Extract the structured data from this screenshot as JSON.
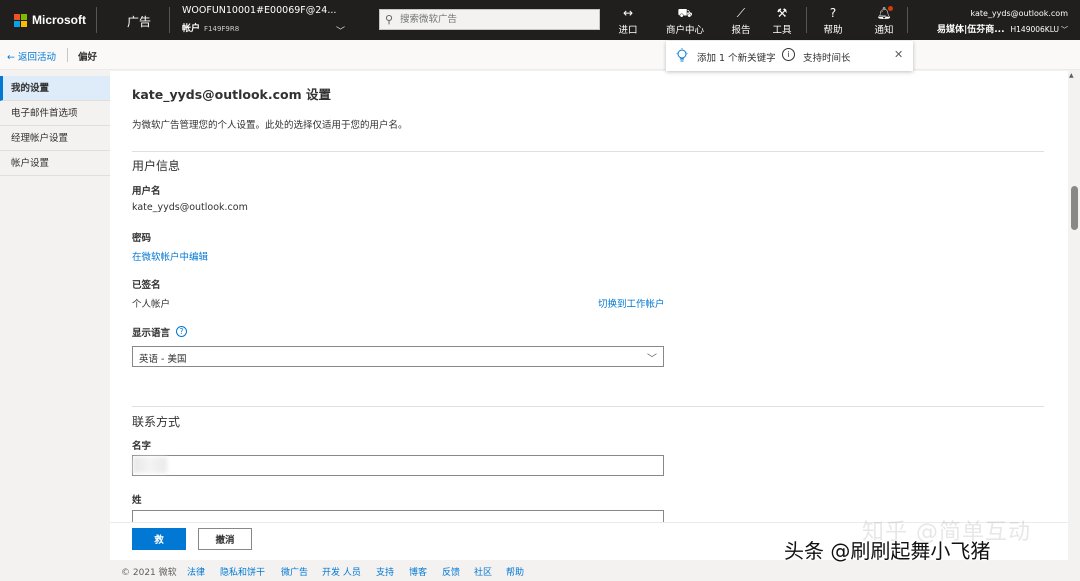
{
  "topbar": {
    "brand": "Microsoft",
    "product": "广告",
    "account": {
      "line1": "WOOFUN10001#E00069F@24...",
      "label": "帐户",
      "id": "F149F9R8"
    },
    "search": {
      "placeholder": "搜索微软广告"
    },
    "items": [
      {
        "icon": "import-icon",
        "label": "进口"
      },
      {
        "icon": "cart-icon",
        "label": "商户中心"
      },
      {
        "icon": "chart-icon",
        "label": "报告"
      },
      {
        "icon": "wrench-icon",
        "label": "工具"
      },
      {
        "icon": "help-icon",
        "label": "帮助"
      },
      {
        "icon": "bell-icon",
        "label": "通知"
      }
    ],
    "user": {
      "email": "kate_yyds@outlook.com",
      "org": "易媒体|伍芬商...",
      "id": "H149006KLU"
    }
  },
  "breadcrumb": {
    "back": "返回活动",
    "current": "偏好"
  },
  "notification": {
    "text1": "添加 1 个新关键字",
    "text2": "支持时间长"
  },
  "leftnav": {
    "items": [
      "我的设置",
      "电子邮件首选项",
      "经理帐户设置",
      "帐户设置"
    ]
  },
  "main": {
    "title": "kate_yyds@outlook.com 设置",
    "description": "为微软广告管理您的个人设置。此处的选择仅适用于您的用户名。",
    "user_info": {
      "section_title": "用户信息",
      "username_label": "用户名",
      "username_value": "kate_yyds@outlook.com",
      "password_label": "密码",
      "password_link": "在微软帐户中编辑",
      "signed_label": "已签名",
      "signed_value": "个人帐户",
      "switch_link": "切换到工作帐户",
      "language_label": "显示语言",
      "language_value": "英语 - 美国"
    },
    "contact": {
      "section_title": "联系方式",
      "first_name_label": "名字",
      "last_name_label": "姓"
    }
  },
  "actions": {
    "save": "救",
    "cancel": "撤消"
  },
  "footer": {
    "copyright": "© 2021 微软",
    "links": [
      "法律",
      "隐私和饼干",
      "微广告",
      "开发 人员",
      "支持",
      "博客",
      "反馈",
      "社区",
      "帮助"
    ]
  },
  "watermarks": {
    "zhihu": "知乎 @简单互动",
    "toutiao": "头条 @刷刷起舞小飞猪"
  },
  "colors": {
    "accent": "#0078d4",
    "topbar": "#201f1e",
    "alert": "#d83b01"
  }
}
